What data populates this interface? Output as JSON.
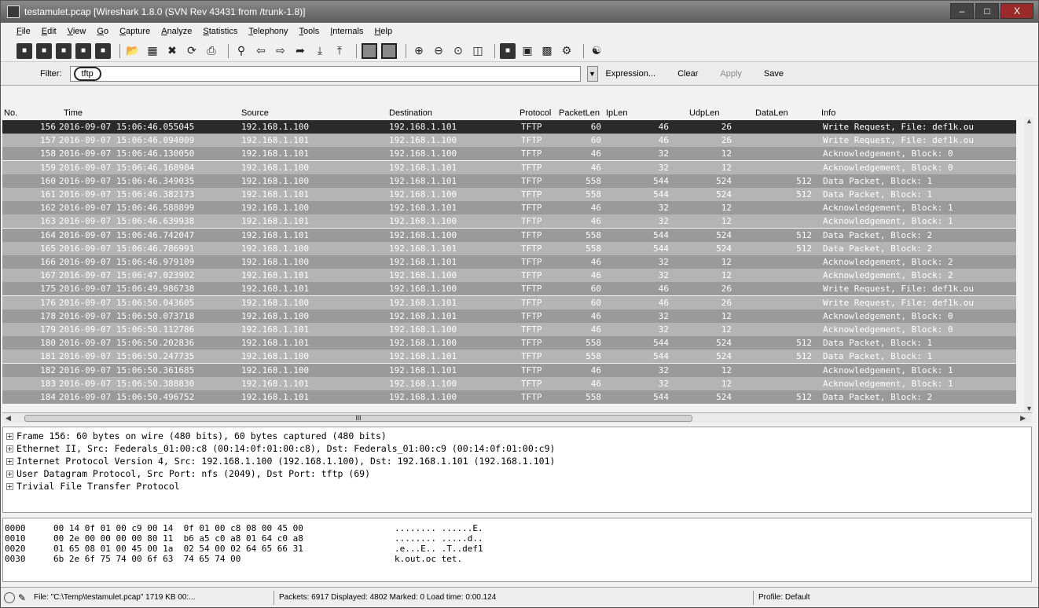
{
  "window": {
    "title": "testamulet.pcap   [Wireshark 1.8.0  (SVN Rev 43431 from /trunk-1.8)]",
    "min_label": "–",
    "max_label": "□",
    "close_label": "X"
  },
  "menu": [
    "File",
    "Edit",
    "View",
    "Go",
    "Capture",
    "Analyze",
    "Statistics",
    "Telephony",
    "Tools",
    "Internals",
    "Help"
  ],
  "filter": {
    "label": "Filter:",
    "value": "tftp",
    "expression_label": "Expression...",
    "clear_label": "Clear",
    "apply_label": "Apply",
    "save_label": "Save"
  },
  "columns": {
    "no": "No.",
    "time": "Time",
    "source": "Source",
    "destination": "Destination",
    "protocol": "Protocol",
    "packetlen": "PacketLen",
    "iplen": "IpLen",
    "udplen": "UdpLen",
    "datalen": "DataLen",
    "info": "Info"
  },
  "packets": [
    {
      "no": "156",
      "time": "2016-09-07 15:06:46.055045",
      "src": "192.168.1.100",
      "dst": "192.168.1.101",
      "proto": "TFTP",
      "plen": "60",
      "iplen": "46",
      "udplen": "26",
      "datalen": "",
      "info": "Write Request, File: def1k.ou"
    },
    {
      "no": "157",
      "time": "2016-09-07 15:06:46.094009",
      "src": "192.168.1.101",
      "dst": "192.168.1.100",
      "proto": "TFTP",
      "plen": "60",
      "iplen": "46",
      "udplen": "26",
      "datalen": "",
      "info": "Write Request, File: def1k.ou"
    },
    {
      "no": "158",
      "time": "2016-09-07 15:06:46.130050",
      "src": "192.168.1.101",
      "dst": "192.168.1.100",
      "proto": "TFTP",
      "plen": "46",
      "iplen": "32",
      "udplen": "12",
      "datalen": "",
      "info": "Acknowledgement, Block: 0"
    },
    {
      "no": "159",
      "time": "2016-09-07 15:06:46.168904",
      "src": "192.168.1.100",
      "dst": "192.168.1.101",
      "proto": "TFTP",
      "plen": "46",
      "iplen": "32",
      "udplen": "12",
      "datalen": "",
      "info": "Acknowledgement, Block: 0"
    },
    {
      "no": "160",
      "time": "2016-09-07 15:06:46.349035",
      "src": "192.168.1.100",
      "dst": "192.168.1.101",
      "proto": "TFTP",
      "plen": "558",
      "iplen": "544",
      "udplen": "524",
      "datalen": "512",
      "info": "Data Packet, Block: 1"
    },
    {
      "no": "161",
      "time": "2016-09-07 15:06:46.382173",
      "src": "192.168.1.101",
      "dst": "192.168.1.100",
      "proto": "TFTP",
      "plen": "558",
      "iplen": "544",
      "udplen": "524",
      "datalen": "512",
      "info": "Data Packet, Block: 1"
    },
    {
      "no": "162",
      "time": "2016-09-07 15:06:46.588899",
      "src": "192.168.1.100",
      "dst": "192.168.1.101",
      "proto": "TFTP",
      "plen": "46",
      "iplen": "32",
      "udplen": "12",
      "datalen": "",
      "info": "Acknowledgement, Block: 1"
    },
    {
      "no": "163",
      "time": "2016-09-07 15:06:46.639938",
      "src": "192.168.1.101",
      "dst": "192.168.1.100",
      "proto": "TFTP",
      "plen": "46",
      "iplen": "32",
      "udplen": "12",
      "datalen": "",
      "info": "Acknowledgement, Block: 1"
    },
    {
      "no": "164",
      "time": "2016-09-07 15:06:46.742047",
      "src": "192.168.1.101",
      "dst": "192.168.1.100",
      "proto": "TFTP",
      "plen": "558",
      "iplen": "544",
      "udplen": "524",
      "datalen": "512",
      "info": "Data Packet, Block: 2"
    },
    {
      "no": "165",
      "time": "2016-09-07 15:06:46.786991",
      "src": "192.168.1.100",
      "dst": "192.168.1.101",
      "proto": "TFTP",
      "plen": "558",
      "iplen": "544",
      "udplen": "524",
      "datalen": "512",
      "info": "Data Packet, Block: 2"
    },
    {
      "no": "166",
      "time": "2016-09-07 15:06:46.979109",
      "src": "192.168.1.100",
      "dst": "192.168.1.101",
      "proto": "TFTP",
      "plen": "46",
      "iplen": "32",
      "udplen": "12",
      "datalen": "",
      "info": "Acknowledgement, Block: 2"
    },
    {
      "no": "167",
      "time": "2016-09-07 15:06:47.023902",
      "src": "192.168.1.101",
      "dst": "192.168.1.100",
      "proto": "TFTP",
      "plen": "46",
      "iplen": "32",
      "udplen": "12",
      "datalen": "",
      "info": "Acknowledgement, Block: 2"
    },
    {
      "no": "175",
      "time": "2016-09-07 15:06:49.986738",
      "src": "192.168.1.101",
      "dst": "192.168.1.100",
      "proto": "TFTP",
      "plen": "60",
      "iplen": "46",
      "udplen": "26",
      "datalen": "",
      "info": "Write Request, File: def1k.ou"
    },
    {
      "no": "176",
      "time": "2016-09-07 15:06:50.043605",
      "src": "192.168.1.100",
      "dst": "192.168.1.101",
      "proto": "TFTP",
      "plen": "60",
      "iplen": "46",
      "udplen": "26",
      "datalen": "",
      "info": "Write Request, File: def1k.ou"
    },
    {
      "no": "178",
      "time": "2016-09-07 15:06:50.073718",
      "src": "192.168.1.100",
      "dst": "192.168.1.101",
      "proto": "TFTP",
      "plen": "46",
      "iplen": "32",
      "udplen": "12",
      "datalen": "",
      "info": "Acknowledgement, Block: 0"
    },
    {
      "no": "179",
      "time": "2016-09-07 15:06:50.112786",
      "src": "192.168.1.101",
      "dst": "192.168.1.100",
      "proto": "TFTP",
      "plen": "46",
      "iplen": "32",
      "udplen": "12",
      "datalen": "",
      "info": "Acknowledgement, Block: 0"
    },
    {
      "no": "180",
      "time": "2016-09-07 15:06:50.202836",
      "src": "192.168.1.101",
      "dst": "192.168.1.100",
      "proto": "TFTP",
      "plen": "558",
      "iplen": "544",
      "udplen": "524",
      "datalen": "512",
      "info": "Data Packet, Block: 1"
    },
    {
      "no": "181",
      "time": "2016-09-07 15:06:50.247735",
      "src": "192.168.1.100",
      "dst": "192.168.1.101",
      "proto": "TFTP",
      "plen": "558",
      "iplen": "544",
      "udplen": "524",
      "datalen": "512",
      "info": "Data Packet, Block: 1"
    },
    {
      "no": "182",
      "time": "2016-09-07 15:06:50.361685",
      "src": "192.168.1.100",
      "dst": "192.168.1.101",
      "proto": "TFTP",
      "plen": "46",
      "iplen": "32",
      "udplen": "12",
      "datalen": "",
      "info": "Acknowledgement, Block: 1"
    },
    {
      "no": "183",
      "time": "2016-09-07 15:06:50.388830",
      "src": "192.168.1.101",
      "dst": "192.168.1.100",
      "proto": "TFTP",
      "plen": "46",
      "iplen": "32",
      "udplen": "12",
      "datalen": "",
      "info": "Acknowledgement, Block: 1"
    },
    {
      "no": "184",
      "time": "2016-09-07 15:06:50.496752",
      "src": "192.168.1.101",
      "dst": "192.168.1.100",
      "proto": "TFTP",
      "plen": "558",
      "iplen": "544",
      "udplen": "524",
      "datalen": "512",
      "info": "Data Packet, Block: 2"
    }
  ],
  "selected_packet": "156",
  "hscroll_label": "III",
  "details": [
    "Frame 156: 60 bytes on wire (480 bits), 60 bytes captured (480 bits)",
    "Ethernet II, Src: Federals_01:00:c8 (00:14:0f:01:00:c8), Dst: Federals_01:00:c9 (00:14:0f:01:00:c9)",
    "Internet Protocol Version 4, Src: 192.168.1.100 (192.168.1.100), Dst: 192.168.1.101 (192.168.1.101)",
    "User Datagram Protocol, Src Port: nfs (2049), Dst Port: tftp (69)",
    "Trivial File Transfer Protocol"
  ],
  "bytes": [
    {
      "offset": "0000",
      "hex": "00 14 0f 01 00 c9 00 14  0f 01 00 c8 08 00 45 00",
      "ascii": "........ ......E."
    },
    {
      "offset": "0010",
      "hex": "00 2e 00 00 00 00 80 11  b6 a5 c0 a8 01 64 c0 a8",
      "ascii": "........ .....d.."
    },
    {
      "offset": "0020",
      "hex": "01 65 08 01 00 45 00 1a  02 54 00 02 64 65 66 31",
      "ascii": ".e...E.. .T..def1"
    },
    {
      "offset": "0030",
      "hex": "6b 2e 6f 75 74 00 6f 63  74 65 74 00",
      "ascii": "k.out.oc tet."
    }
  ],
  "status": {
    "file": "File: \"C:\\Temp\\testamulet.pcap\" 1719 KB 00:...",
    "packets": "Packets: 6917 Displayed: 4802 Marked: 0 Load time: 0:00.124",
    "profile": "Profile: Default"
  },
  "colors": {
    "selected_row": "#2a2a2a",
    "row_a": "#9a9a9a",
    "row_b": "#b4b4b4"
  }
}
